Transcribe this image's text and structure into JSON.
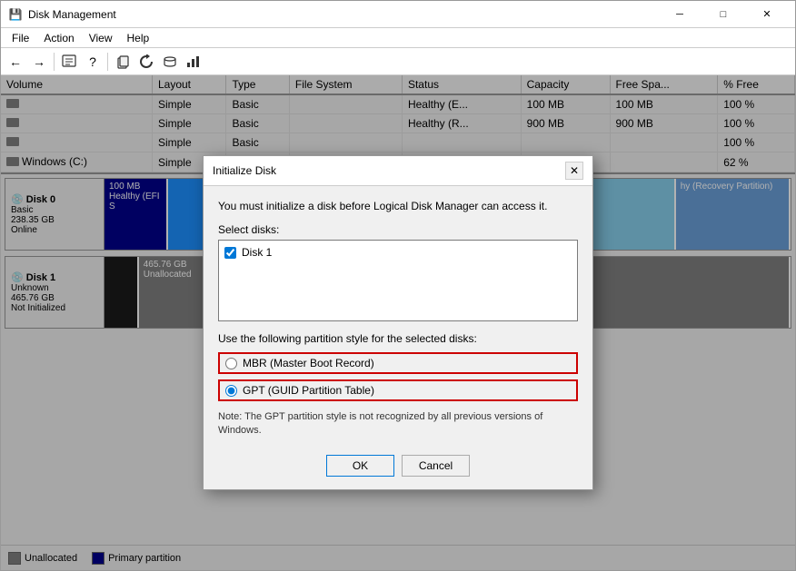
{
  "window": {
    "title": "Disk Management",
    "icon": "💾"
  },
  "menu": {
    "items": [
      "File",
      "Action",
      "View",
      "Help"
    ]
  },
  "toolbar": {
    "buttons": [
      "←",
      "→",
      "📄",
      "?",
      "📋",
      "🔄",
      "💾",
      "📊"
    ]
  },
  "table": {
    "columns": [
      "Volume",
      "Layout",
      "Type",
      "File System",
      "Status",
      "Capacity",
      "Free Spa...",
      "% Free"
    ],
    "rows": [
      {
        "volume": "",
        "layout": "Simple",
        "type": "Basic",
        "filesystem": "",
        "status": "Healthy (E...",
        "capacity": "100 MB",
        "free": "100 MB",
        "pct": "100 %"
      },
      {
        "volume": "",
        "layout": "Simple",
        "type": "Basic",
        "filesystem": "",
        "status": "Healthy (R...",
        "capacity": "900 MB",
        "free": "900 MB",
        "pct": "100 %"
      },
      {
        "volume": "",
        "layout": "Simple",
        "type": "Basic",
        "filesystem": "",
        "status": "",
        "capacity": "",
        "free": "",
        "pct": "100 %"
      },
      {
        "volume": "Windows (C:)",
        "layout": "Simple",
        "type": "",
        "filesystem": "",
        "status": "",
        "capacity": "",
        "free": "",
        "pct": "62 %"
      }
    ]
  },
  "disks": [
    {
      "id": "disk0",
      "name": "Disk 0",
      "type": "Basic",
      "size": "238.35 GB",
      "status": "Online",
      "partitions": [
        {
          "label": "100 MB\nHealthy (EFI S",
          "style": "dark-blue",
          "width": "5%"
        },
        {
          "label": "",
          "style": "medium-blue",
          "width": "50%"
        },
        {
          "label": "",
          "style": "light-blue",
          "width": "25%"
        },
        {
          "label": "hy (Recovery Partition)",
          "style": "recovery",
          "width": "20%"
        }
      ]
    },
    {
      "id": "disk1",
      "name": "Disk 1",
      "type": "Unknown",
      "size": "465.76 GB",
      "status": "Not Initialized",
      "partitions": [
        {
          "label": "465.76 GB\nUnallocated",
          "style": "unallocated",
          "width": "100%"
        }
      ]
    }
  ],
  "legend": [
    {
      "color": "#808080",
      "label": "Unallocated"
    },
    {
      "color": "#00008b",
      "label": "Primary partition"
    }
  ],
  "dialog": {
    "title": "Initialize Disk",
    "description": "You must initialize a disk before Logical Disk Manager can access it.",
    "select_label": "Select disks:",
    "disk_item": "Disk 1",
    "disk_checked": true,
    "partition_label": "Use the following partition style for the selected disks:",
    "options": [
      {
        "id": "mbr",
        "label": "MBR (Master Boot Record)",
        "checked": false
      },
      {
        "id": "gpt",
        "label": "GPT (GUID Partition Table)",
        "checked": true
      }
    ],
    "note": "Note: The GPT partition style is not recognized by all previous versions of\nWindows.",
    "ok_label": "OK",
    "cancel_label": "Cancel"
  }
}
